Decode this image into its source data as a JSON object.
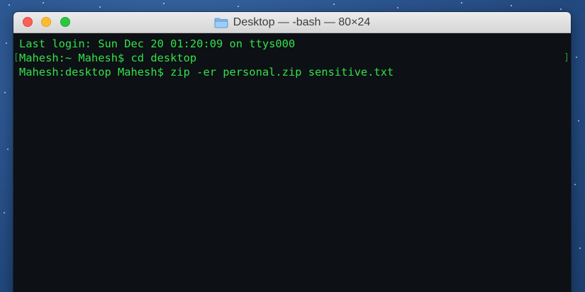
{
  "window": {
    "title": "Desktop — -bash — 80×24"
  },
  "terminal": {
    "lines": [
      "Last login: Sun Dec 20 01:20:09 on ttys000",
      "Mahesh:~ Mahesh$ cd desktop",
      "Mahesh:desktop Mahesh$ zip -er personal.zip sensitive.txt"
    ],
    "mark_open": "[",
    "mark_close": "]"
  },
  "colors": {
    "terminal_text": "#33e14a",
    "terminal_background": "#0d1014",
    "close_button": "#fc5f57",
    "minimize_button": "#fdbc2e",
    "zoom_button": "#29c840"
  },
  "icons": {
    "title": "folder-icon"
  }
}
